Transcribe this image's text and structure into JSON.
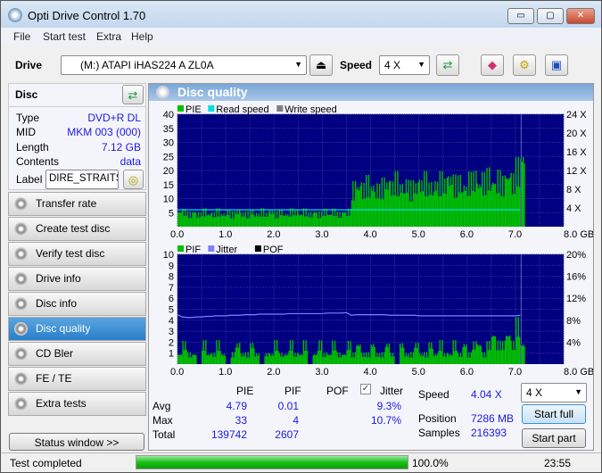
{
  "window": {
    "title": "Opti Drive Control 1.70",
    "minimize": "▭",
    "maximize": "▢",
    "close": "✕"
  },
  "menu": [
    "File",
    "Start test",
    "Extra",
    "Help"
  ],
  "toolbar": {
    "drive_label": "Drive",
    "drive_value": "(M:)   ATAPI iHAS224   A ZL0A",
    "speed_label": "Speed",
    "speed_value": "4 X"
  },
  "disc": {
    "title": "Disc",
    "fields": [
      {
        "k": "Type",
        "v": "DVD+R DL"
      },
      {
        "k": "MID",
        "v": "MKM 003 (000)"
      },
      {
        "k": "Length",
        "v": "7.12 GB"
      },
      {
        "k": "Contents",
        "v": "data"
      }
    ],
    "label_key": "Label",
    "label_value": "DIRE_STRAITS_"
  },
  "nav": [
    "Transfer rate",
    "Create test disc",
    "Verify test disc",
    "Drive info",
    "Disc info",
    "Disc quality",
    "CD Bler",
    "FE / TE",
    "Extra tests"
  ],
  "nav_active": "Disc quality",
  "status_window": "Status window >>",
  "panel_title": "Disc quality",
  "colors": {
    "pie": "#00c000",
    "pif": "#00c000",
    "read": "#00e0e0",
    "jitter": "#8080ff",
    "plot_bg": "#000080",
    "grid": "#3030a0"
  },
  "chart_data": [
    {
      "type": "bar",
      "legend": [
        "PIE",
        "Read speed",
        "Write speed"
      ],
      "xlim": [
        0,
        8
      ],
      "ylim": [
        0,
        40
      ],
      "y2lim": [
        0,
        24
      ],
      "xticks": [
        "0.0",
        "1.0",
        "2.0",
        "3.0",
        "4.0",
        "5.0",
        "6.0",
        "7.0",
        "8.0 GB"
      ],
      "yticks": [
        "5",
        "10",
        "15",
        "20",
        "25",
        "30",
        "35",
        "40"
      ],
      "y2ticks": [
        "4 X",
        "8 X",
        "12 X",
        "16 X",
        "20 X",
        "24 X"
      ],
      "pie_step_gb": 0.1,
      "pie": [
        6,
        6,
        5,
        6,
        5,
        6,
        5,
        5,
        6,
        5,
        6,
        5,
        6,
        5,
        5,
        6,
        5,
        6,
        5,
        6,
        5,
        6,
        5,
        6,
        6,
        5,
        6,
        5,
        6,
        5,
        6,
        5,
        6,
        5,
        6,
        6,
        15,
        16,
        15,
        17,
        16,
        15,
        16,
        17,
        16,
        18,
        16,
        17,
        15,
        16,
        17,
        18,
        16,
        17,
        18,
        17,
        19,
        17,
        18,
        16,
        18,
        19,
        17,
        18,
        20,
        18,
        19,
        17,
        20,
        18,
        23,
        28
      ],
      "read_speed_x": 3.6
    },
    {
      "type": "bar",
      "legend": [
        "PIF",
        "Jitter",
        "POF"
      ],
      "xlim": [
        0,
        8
      ],
      "ylim": [
        0,
        10
      ],
      "y2lim": [
        0,
        20
      ],
      "xticks": [
        "0.0",
        "1.0",
        "2.0",
        "3.0",
        "4.0",
        "5.0",
        "6.0",
        "7.0",
        "8.0 GB"
      ],
      "yticks": [
        "1",
        "2",
        "3",
        "4",
        "5",
        "6",
        "7",
        "8",
        "9",
        "10"
      ],
      "y2ticks": [
        "4%",
        "8%",
        "12%",
        "16%",
        "20%"
      ],
      "pif": [
        1,
        2,
        1,
        1,
        0,
        2,
        1,
        1,
        2,
        1,
        0,
        1,
        2,
        1,
        1,
        2,
        1,
        0,
        1,
        1,
        2,
        1,
        1,
        2,
        1,
        1,
        2,
        0,
        1,
        2,
        1,
        1,
        2,
        1,
        1,
        2,
        1,
        2,
        1,
        1,
        2,
        1,
        1,
        2,
        1,
        0,
        2,
        1,
        1,
        2,
        1,
        1,
        2,
        1,
        2,
        1,
        1,
        2,
        1,
        2,
        1,
        2,
        2,
        1,
        2,
        3,
        2,
        2,
        3,
        2,
        4,
        2
      ],
      "jitter": [
        9.0,
        8.6,
        8.5,
        8.5,
        8.6,
        8.6,
        8.7,
        8.7,
        8.8,
        8.8,
        8.8,
        8.9,
        8.9,
        8.9,
        9.0,
        9.0,
        9.0,
        9.1,
        9.1,
        9.1,
        9.1,
        9.1,
        9.1,
        9.2,
        9.2,
        9.2,
        9.2,
        9.2,
        9.2,
        9.2,
        9.2,
        9.3,
        9.3,
        9.3,
        9.3,
        9.4,
        8.9,
        9.0,
        9.0,
        9.0,
        9.0,
        9.0,
        9.0,
        9.0,
        8.9,
        8.9,
        8.9,
        8.9,
        8.9,
        8.9,
        8.8,
        8.8,
        8.8,
        8.8,
        8.8,
        8.8,
        8.8,
        8.8,
        8.8,
        8.8,
        8.8,
        8.8,
        8.8,
        8.8,
        8.8,
        8.8,
        8.8,
        8.8,
        8.8,
        8.8,
        8.8,
        8.9
      ]
    }
  ],
  "stats": {
    "headers": [
      "PIE",
      "PIF",
      "POF",
      "Jitter"
    ],
    "rows": [
      {
        "k": "Avg",
        "pie": "4.79",
        "pif": "0.01",
        "jit": "9.3%"
      },
      {
        "k": "Max",
        "pie": "33",
        "pif": "4",
        "jit": "10.7%"
      },
      {
        "k": "Total",
        "pie": "139742",
        "pif": "2607",
        "jit": ""
      }
    ],
    "jitter_checked": true
  },
  "info": {
    "speed_k": "Speed",
    "speed_v": "4.04 X",
    "pos_k": "Position",
    "pos_v": "7286 MB",
    "samp_k": "Samples",
    "samp_v": "216393"
  },
  "controls": {
    "speed": "4 X",
    "start_full": "Start full",
    "start_part": "Start part"
  },
  "status": {
    "text": "Test completed",
    "progress": 100,
    "progress_text": "100.0%",
    "time": "23:55"
  }
}
